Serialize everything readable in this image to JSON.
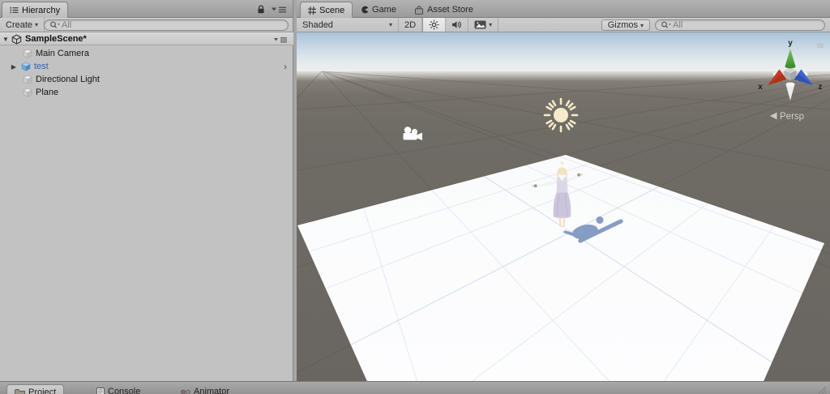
{
  "hierarchy": {
    "tab_label": "Hierarchy",
    "create_label": "Create",
    "search_placeholder": "All",
    "scene_name": "SampleScene*",
    "items": [
      {
        "label": "Main Camera"
      },
      {
        "label": "test"
      },
      {
        "label": "Directional Light"
      },
      {
        "label": "Plane"
      }
    ]
  },
  "scene_view": {
    "tabs": {
      "scene": "Scene",
      "game": "Game",
      "asset_store": "Asset Store"
    },
    "toolbar": {
      "shading_mode": "Shaded",
      "mode_2d": "2D",
      "gizmos_label": "Gizmos",
      "search_placeholder": "All"
    },
    "gizmo": {
      "x": "x",
      "y": "y",
      "z": "z",
      "projection": "Persp"
    }
  },
  "bottom_tabs": {
    "project": "Project",
    "console": "Console",
    "animator": "Animator"
  },
  "glyphs": {
    "dropdown_arrow": "▾",
    "disclosure_open": "▼",
    "disclosure_closed": "▶",
    "row_chevron": "›"
  },
  "icons": {
    "hierarchy_tab": "list-icon",
    "scene_tab": "grid-hash-icon",
    "game_tab": "pacman-c-icon",
    "asset_store_tab": "shopping-bag-icon",
    "lock": "padlock-icon",
    "panel_menu": "dropdown-burger-icon",
    "search": "magnifier-icon",
    "lighting": "sun-icon",
    "audio": "speaker-icon",
    "effects": "picture-icon",
    "project_tab": "folder-icon",
    "console_tab": "console-page-icon",
    "animator_tab": "state-dots-icon"
  },
  "colors": {
    "prefab_blue": "#2a63b8",
    "sky_top": "#aac2d8",
    "ground": "#6e6a64",
    "plane_white": "#fbfcfd",
    "plane_grid_blue": "#ccd8ea",
    "shadow_blue": "#7b95c0",
    "sun_gizmo": "#f5ebc8",
    "axis_x_red": "#c13a24",
    "axis_y_green": "#57a33b",
    "axis_z_blue": "#2d55c0"
  }
}
